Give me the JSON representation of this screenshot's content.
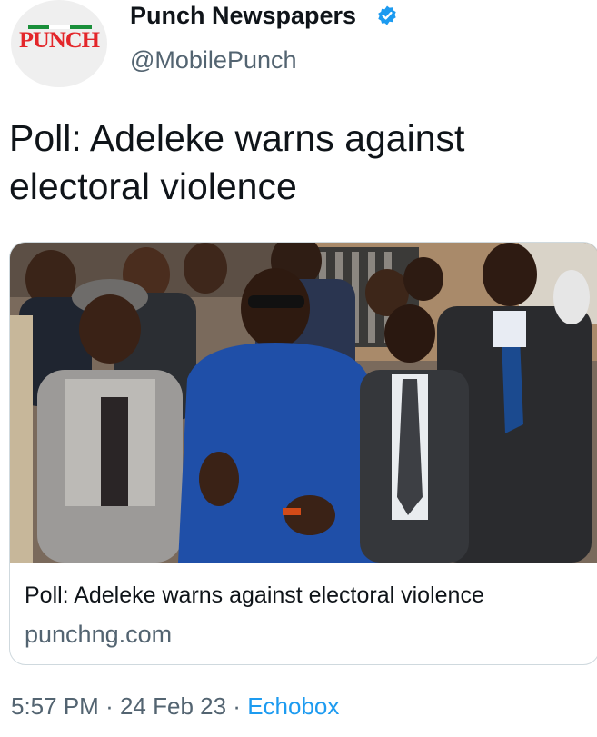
{
  "author": {
    "avatar_logo_text": "PUNCH",
    "name": "Punch Newspapers",
    "handle": "@MobilePunch",
    "verified_color": "#1d9bf0"
  },
  "tweet": {
    "text": "Poll: Adeleke warns against electoral violence"
  },
  "card": {
    "title": "Poll: Adeleke warns against electoral violence",
    "domain": "punchng.com"
  },
  "meta": {
    "time": "5:57 PM",
    "separator": "·",
    "date": "24 Feb 23",
    "source": "Echobox",
    "source_color": "#1d9bf0"
  },
  "icons": [
    "verified-badge-icon"
  ]
}
